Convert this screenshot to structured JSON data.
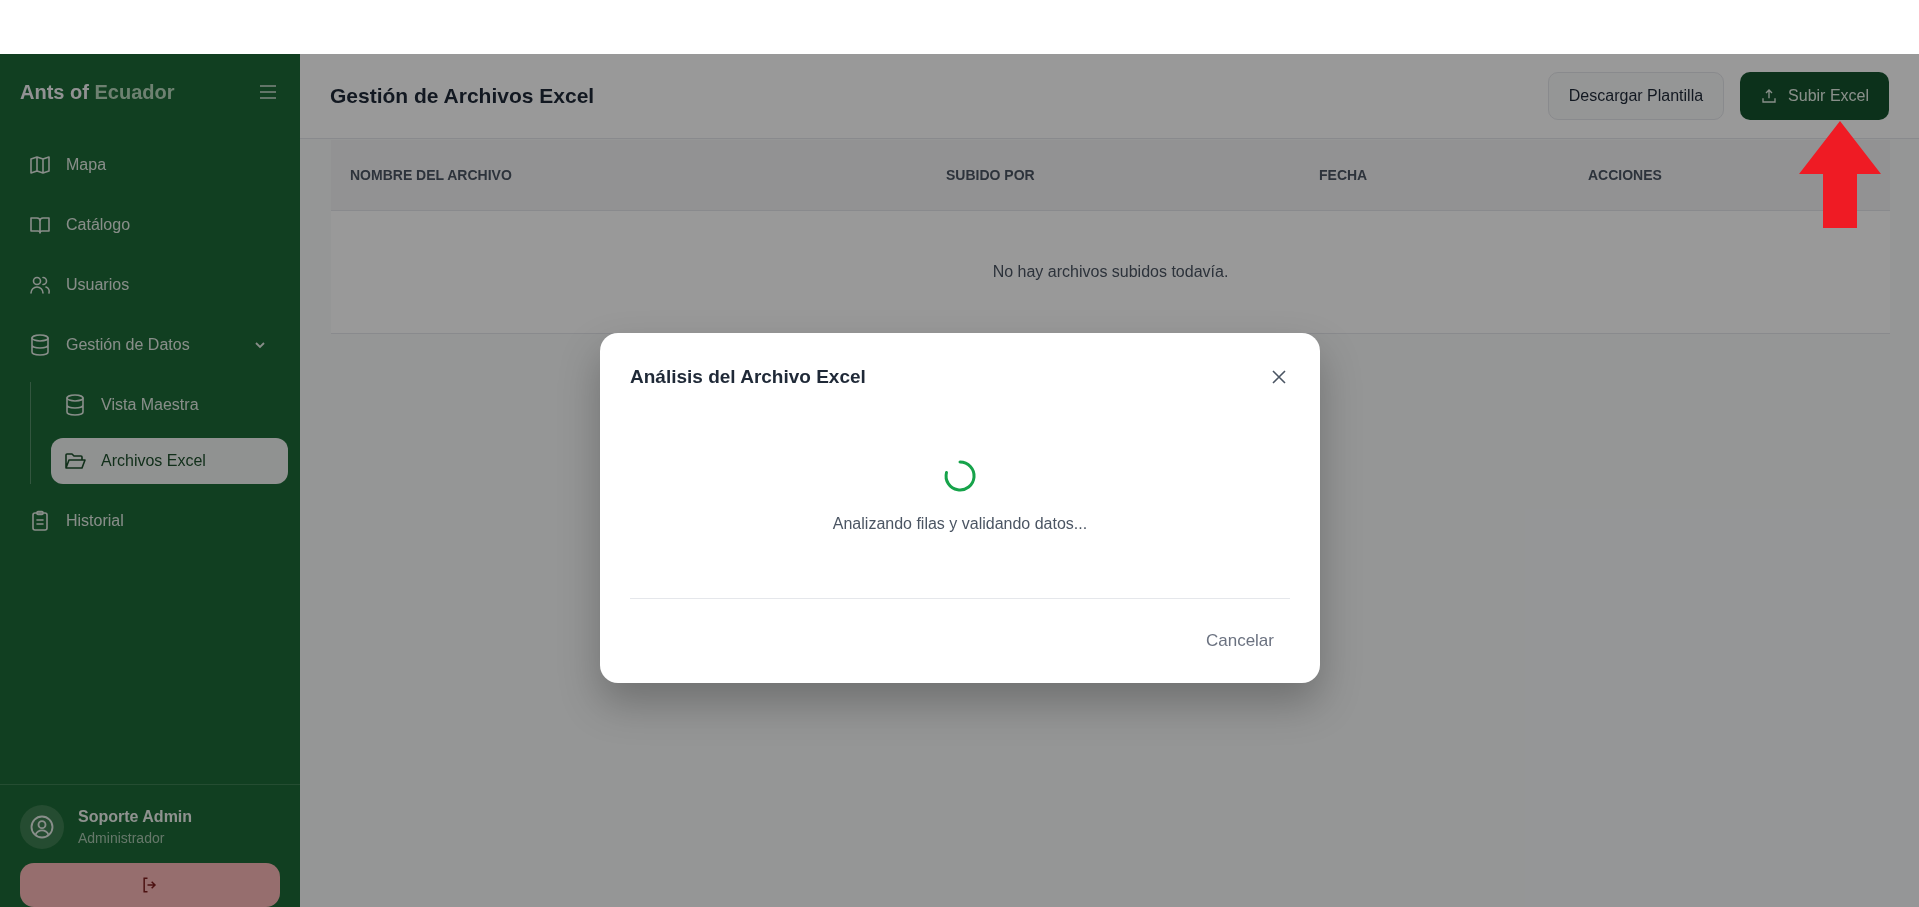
{
  "sidebar": {
    "brand": {
      "part_1": "Ants of",
      "part_2": "Ecuador"
    },
    "items": [
      {
        "label": "Mapa",
        "kind": "map",
        "selected": false
      },
      {
        "label": "Catálogo",
        "kind": "book",
        "selected": false
      },
      {
        "label": "Usuarios",
        "kind": "users",
        "selected": false
      },
      {
        "label": "Gestión de Datos",
        "kind": "database",
        "selected": false,
        "expanded": true,
        "children": [
          {
            "label": "Vista Maestra",
            "kind": "database",
            "selected": false
          },
          {
            "label": "Archivos Excel",
            "kind": "folder",
            "selected": true
          }
        ]
      },
      {
        "label": "Historial",
        "kind": "clipboard",
        "selected": false
      }
    ],
    "user": {
      "name": "Soporte Admin",
      "role": "Administrador"
    }
  },
  "header": {
    "title": "Gestión de Archivos Excel",
    "buttons": [
      {
        "label": "Descargar Plantilla",
        "kind": "secondary"
      },
      {
        "label": "Subir Excel",
        "kind": "primary"
      }
    ]
  },
  "table": {
    "columns": [
      "NOMBRE DEL ARCHIVO",
      "SUBIDO POR",
      "FECHA",
      "ACCIONES"
    ],
    "empty_message": "No hay archivos subidos todavía."
  },
  "dialog": {
    "title": "Análisis del Archivo Excel",
    "message": "Analizando filas y validando datos...",
    "buttons": [
      "Cancelar"
    ]
  }
}
